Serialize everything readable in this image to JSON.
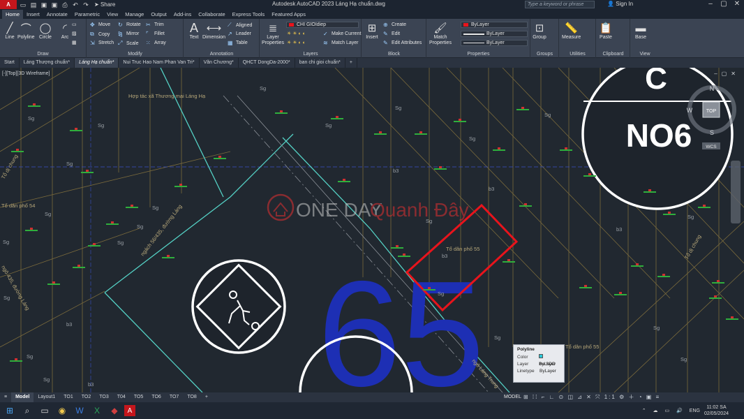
{
  "titlebar": {
    "logo": "A",
    "share": "Share",
    "title": "Autodesk AutoCAD 2023   Láng Hạ chuẩn.dwg",
    "search_placeholder": "Type a keyword or phrase",
    "signin": "Sign In"
  },
  "ribbon_tabs": [
    "Home",
    "Insert",
    "Annotate",
    "Parametric",
    "View",
    "Manage",
    "Output",
    "Add-ins",
    "Collaborate",
    "Express Tools",
    "Featured Apps"
  ],
  "ribbon": {
    "draw": {
      "title": "Draw",
      "line": "Line",
      "polyline": "Polyline",
      "circle": "Circle",
      "arc": "Arc"
    },
    "modify": {
      "title": "Modify",
      "move": "Move",
      "rotate": "Rotate",
      "trim": "Trim",
      "copy": "Copy",
      "mirror": "Mirror",
      "fillet": "Fillet",
      "stretch": "Stretch",
      "scale": "Scale",
      "array": "Array"
    },
    "annotation": {
      "title": "Annotation",
      "text": "Text",
      "dimension": "Dimension",
      "aligned": "Aligned",
      "leader": "Leader",
      "table": "Table"
    },
    "layers": {
      "title": "Layers",
      "layer_properties": "Layer Properties",
      "current_layer": "CHI GIOIdiep",
      "make_current": "Make Current",
      "match_layer": "Match Layer"
    },
    "block": {
      "title": "Block",
      "insert": "Insert",
      "create": "Create",
      "edit": "Edit",
      "edit_attributes": "Edit Attributes"
    },
    "properties": {
      "title": "Properties",
      "match_properties": "Match Properties",
      "color": "ByLayer",
      "lineweight": "ByLayer",
      "linetype": "ByLayer"
    },
    "groups": {
      "title": "Groups",
      "group": "Group"
    },
    "utilities": {
      "title": "Utilities",
      "measure": "Measure"
    },
    "clipboard": {
      "title": "Clipboard",
      "paste": "Paste"
    },
    "view": {
      "title": "View",
      "base": "Base"
    }
  },
  "doc_tabs": [
    "Start",
    "Láng Thượng chuẩn*",
    "Láng Hạ chuẩn*",
    "Nui Truc Hao Nam Phan Van Tri*",
    "Văn Chương*",
    "QHCT DongDa-2000*",
    "ban chi gioi chuẩn*"
  ],
  "viewport_label": "[-][Top][3D Wireframe]",
  "drawing": {
    "labels": {
      "hop_tac_xa": "Hợp tác xã Thương mại Láng Hạ",
      "to_dan_pho_55": "Tổ dân phố 55",
      "to_dan_pho_55b": "Tổ dân phố 55",
      "to_dan_pho_54": "Tổ dân phố 54",
      "ngach": "ngách 56/435, đường Láng",
      "duong_lang": "ngõ 435, đường Láng",
      "ngo_lang_trung": "ngõ Láng Trung",
      "do_chung": "Tổ dị chung",
      "do_chung2": "Tổ dị chung",
      "big_number": "65",
      "plot_code": "NO6",
      "cap_c": "C",
      "watermark_one": "ONE DAY",
      "watermark_quanh": "Quanh Đây",
      "sg": "Sg",
      "b3": "b3"
    },
    "viewcube": {
      "top": "TOP",
      "n": "N",
      "s": "S",
      "w": "W",
      "wcs": "WCS"
    }
  },
  "tooltip": {
    "title": "Polyline",
    "rows": [
      {
        "key": "Color",
        "value": "ByLayer"
      },
      {
        "key": "Layer",
        "value": "bo SDD"
      },
      {
        "key": "Linetype",
        "value": "ByLayer"
      }
    ]
  },
  "layout_tabs": [
    "Model",
    "Layout1",
    "TO1",
    "TO2",
    "TO3",
    "T04",
    "TO5",
    "TO6",
    "TO7",
    "TO8"
  ],
  "status": {
    "model": "MODEL",
    "scale": "1:1"
  },
  "taskbar": {
    "lang": "ENG",
    "time": "11:02 SA",
    "date": "02/05/2024"
  },
  "colors": {
    "accent_red": "#e8141c",
    "canvas_bg": "#212830",
    "parcel_line": "#7a6a3c",
    "road_cyan": "#54d0c4",
    "big_number_blue": "#1d2fb4"
  }
}
